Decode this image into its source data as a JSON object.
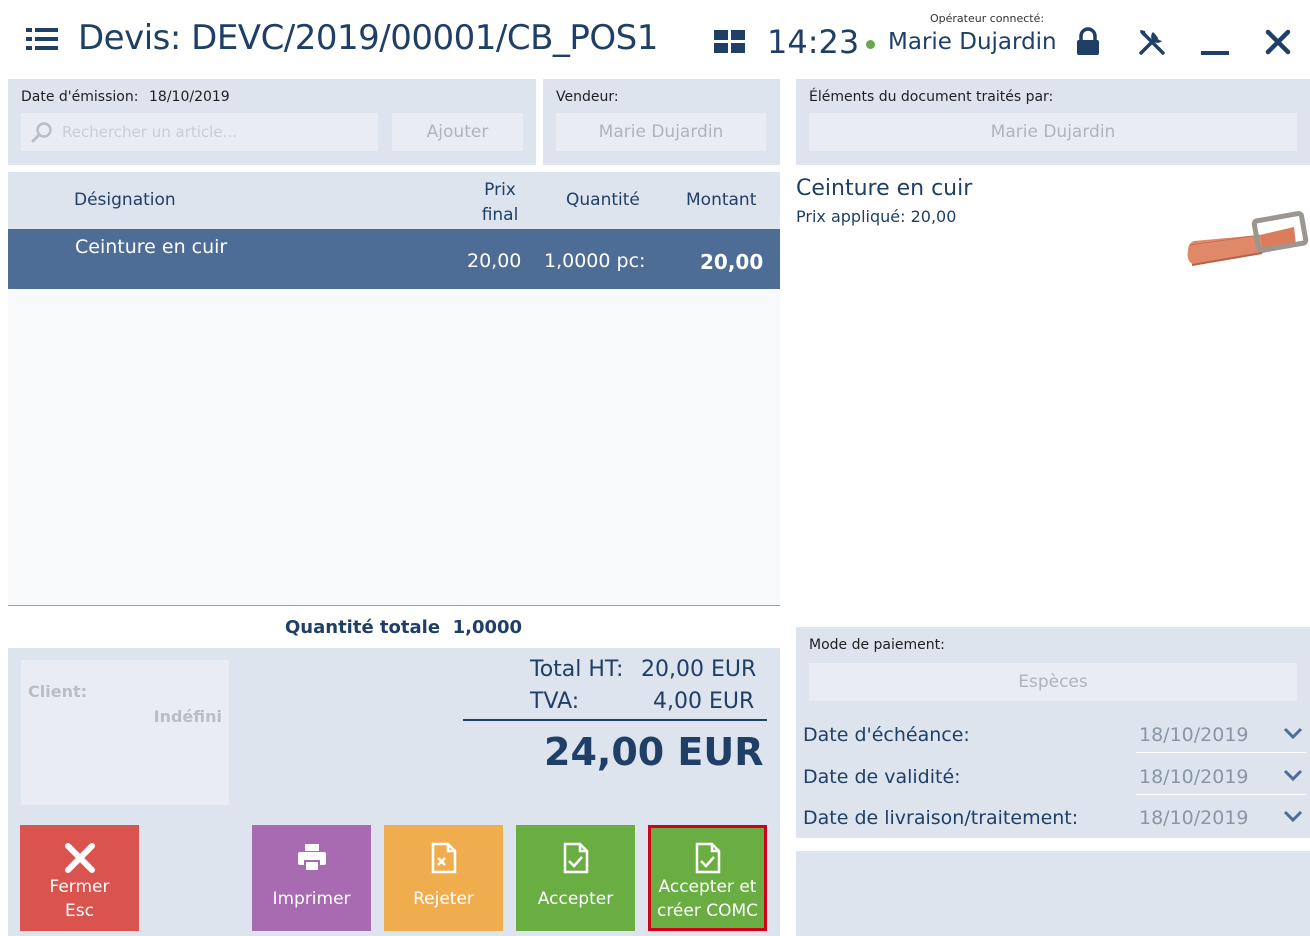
{
  "header": {
    "title": "Devis: DEVC/2019/00001/CB_POS1",
    "time": "14:23",
    "operator_label": "Opérateur connecté:",
    "operator_name": "Marie Dujardin",
    "icons": [
      "menu-icon",
      "tiles-icon",
      "lock-icon",
      "tools-icon",
      "minimize-icon",
      "close-icon"
    ]
  },
  "top_left": {
    "date_label": "Date d'émission:",
    "date_value": "18/10/2019",
    "search_placeholder": "Rechercher un article...",
    "add_label": "Ajouter"
  },
  "vendor": {
    "label": "Vendeur:",
    "value": "Marie Dujardin"
  },
  "processed": {
    "label": "Éléments du document traités par:",
    "value": "Marie Dujardin"
  },
  "grid": {
    "columns": [
      "Désignation",
      "Prix final",
      "Quantité",
      "Montant"
    ],
    "col_prix_line1": "Prix",
    "col_prix_line2": "final",
    "rows": [
      {
        "name": "Ceinture en cuir",
        "price": "20,00",
        "qty": "1,0000 pc:",
        "amount": "20,00"
      }
    ],
    "total_qty_label": "Quantité totale",
    "total_qty_value": "1,0000"
  },
  "client": {
    "label": "Client:",
    "value": "Indéfini"
  },
  "totals": {
    "ht_label": "Total HT:",
    "ht_value": "20,00 EUR",
    "tva_label": "TVA:",
    "tva_value": "4,00 EUR",
    "grand_total": "24,00 EUR"
  },
  "detail": {
    "name": "Ceinture en cuir",
    "price_label": "Prix appliqué:",
    "price_value": "20,00"
  },
  "payment": {
    "label": "Mode de paiement:",
    "value": "Espèces"
  },
  "dates": [
    {
      "label": "Date d'échéance:",
      "value": "18/10/2019"
    },
    {
      "label": "Date de validité:",
      "value": "18/10/2019"
    },
    {
      "label": "Date de livraison/traitement:",
      "value": "18/10/2019"
    }
  ],
  "buttons": {
    "close_line1": "Fermer",
    "close_line2": "Esc",
    "print": "Imprimer",
    "reject": "Rejeter",
    "accept": "Accepter",
    "accept_create_line1": "Accepter et",
    "accept_create_line2": "créer COMC"
  },
  "colors": {
    "brand": "#1f3f66",
    "selected_row": "#4d6d96",
    "panel": "#dde4ee",
    "close_btn": "#d9534f",
    "print_btn": "#a86ab0",
    "reject_btn": "#f0ad4e",
    "accept_btn": "#6aad42",
    "highlight_border": "#d0021b"
  }
}
